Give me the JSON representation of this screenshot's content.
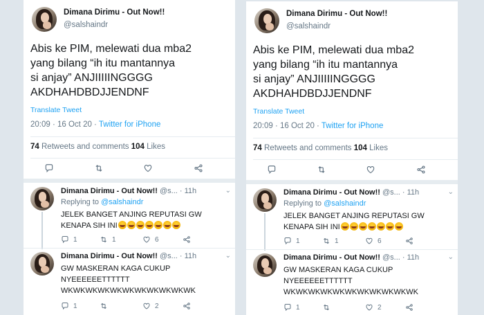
{
  "tweet": {
    "name": "Dimana Dirimu - Out Now!!",
    "handle": "@salshaindr",
    "text_lines": [
      "Abis ke PIM, melewati dua mba2",
      "yang bilang “ih itu mantannya",
      "si anjay” ANJIIIIINGGGG",
      "AKDHAHDBDJJENDNF"
    ],
    "translate": "Translate Tweet",
    "time": "20:09 · 16 Oct 20 · ",
    "client": "Twitter for iPhone",
    "retweets_count": "74",
    "retweets_label": " Retweets and comments ",
    "likes_count": "104",
    "likes_label": " Likes"
  },
  "replies": [
    {
      "name": "Dimana Dirimu - Out Now!!",
      "handle_time": " @s... · 11h",
      "replying_prefix": "Replying to ",
      "replying_to": "@salshaindr",
      "text_lines": [
        "JELEK BANGET ANJING REPUTASI GW",
        "KENAPA SIH INI"
      ],
      "emoji_name": "loudly-crying-face",
      "emoji_count": 7,
      "reply_count": "1",
      "retweet_count": "1",
      "like_count": "6"
    },
    {
      "name": "Dimana Dirimu - Out Now!!",
      "handle_time": " @s... · 11h",
      "text_lines": [
        "GW MASKERAN KAGA CUKUP",
        "NYEEEEEETTTTTT",
        "WKWKWKWKWKWKWKWKWKWKWK"
      ],
      "reply_count": "1",
      "retweet_count": "",
      "like_count": "2"
    }
  ],
  "icons": {
    "reply": "reply-icon",
    "retweet": "retweet-icon",
    "like": "heart-icon",
    "share": "share-icon",
    "more": "chevron-down-icon"
  },
  "colors": {
    "accent": "#1da1f2",
    "secondary_text": "#657786",
    "primary_text": "#14171a",
    "background": "#dfe6ec"
  }
}
